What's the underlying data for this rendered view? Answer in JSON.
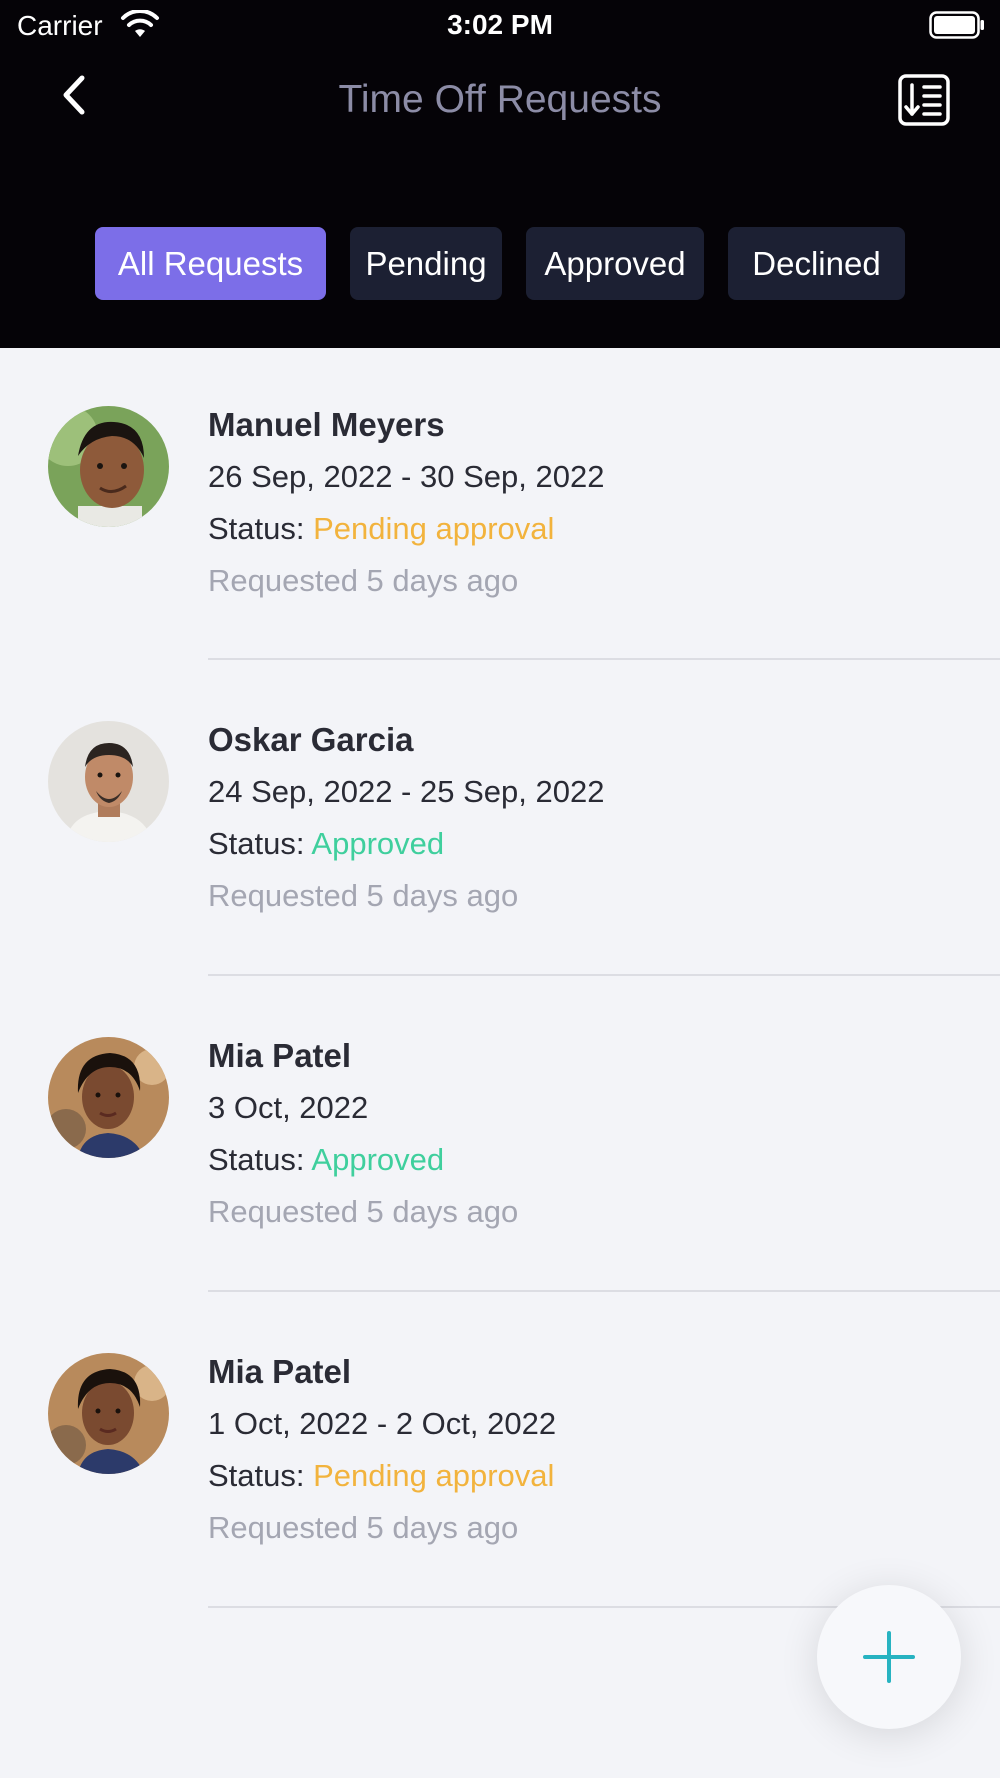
{
  "status_bar": {
    "carrier": "Carrier",
    "time": "3:02 PM"
  },
  "header": {
    "title": "Time Off Requests"
  },
  "tabs": [
    {
      "label": "All Requests",
      "active": true
    },
    {
      "label": "Pending",
      "active": false
    },
    {
      "label": "Approved",
      "active": false
    },
    {
      "label": "Declined",
      "active": false
    }
  ],
  "requests": [
    {
      "name": "Manuel Meyers",
      "dates": "26 Sep, 2022 - 30 Sep, 2022",
      "status_label": "Status:",
      "status": "Pending approval",
      "requested": "Requested 5 days ago"
    },
    {
      "name": "Oskar Garcia",
      "dates": "24 Sep, 2022 - 25 Sep, 2022",
      "status_label": "Status:",
      "status": "Approved",
      "requested": "Requested 5 days ago"
    },
    {
      "name": "Mia Patel",
      "dates": "3 Oct, 2022",
      "status_label": "Status:",
      "status": "Approved",
      "requested": "Requested 5 days ago"
    },
    {
      "name": "Mia Patel",
      "dates": "1 Oct, 2022 - 2 Oct, 2022",
      "status_label": "Status:",
      "status": "Pending approval",
      "requested": "Requested 5 days ago"
    }
  ],
  "colors": {
    "accent": "#7c6ee8",
    "pending": "#f2b33d",
    "approved": "#3fcf9d",
    "fab_plus": "#27b3c1",
    "header_bg": "#050307",
    "tab_bg": "#1c2033"
  },
  "icons": {
    "back": "chevron-left-icon",
    "sort": "sort-list-icon",
    "fab": "plus-icon",
    "wifi": "wifi-icon",
    "battery": "battery-icon"
  }
}
